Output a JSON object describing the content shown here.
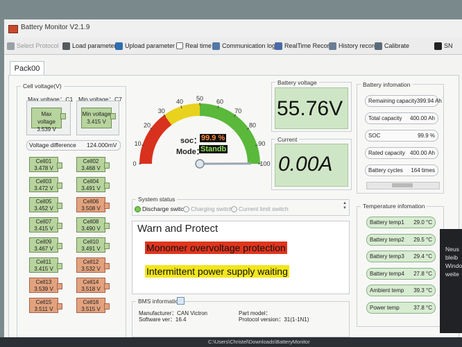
{
  "window": {
    "title": "Battery Monitor V2.1.9"
  },
  "toolbar": [
    {
      "label": "Select Protocol",
      "icon": "protocol-icon",
      "color": "#9aa0a6",
      "disabled": true
    },
    {
      "label": "Load parameter",
      "icon": "load-icon",
      "color": "#555a60",
      "disabled": false
    },
    {
      "label": "Upload parameter",
      "icon": "upload-icon",
      "color": "#2f6db0",
      "disabled": false
    },
    {
      "label": "Real time",
      "icon": "checkbox-icon",
      "color": "#3d3d3d",
      "disabled": false
    },
    {
      "label": "Communication log",
      "icon": "log-icon",
      "color": "#5277a6",
      "disabled": false
    },
    {
      "label": "RealTime Record",
      "icon": "record-icon",
      "color": "#4a6aa8",
      "disabled": false
    },
    {
      "label": "History record",
      "icon": "history-icon",
      "color": "#6a7d95",
      "disabled": false
    },
    {
      "label": "Calibrate",
      "icon": "calibrate-icon",
      "color": "#5b6a78",
      "disabled": false
    },
    {
      "label": "SN",
      "icon": "barcode-icon",
      "color": "#222222",
      "disabled": false
    }
  ],
  "tab": {
    "label": "Pack00"
  },
  "cell_voltage": {
    "group_label": "Cell voltage(V)",
    "max_header": "Max voltage：C1",
    "min_header": "Min voltage：C7",
    "max_name": "Max voltage",
    "max_value": "3.539 V",
    "min_name": "Min voltage",
    "min_value": "3.415 V",
    "diff_label": "Voltage difference",
    "diff_value": "124.000mV",
    "cells": [
      {
        "name": "Cell01",
        "value": "3.478 V",
        "state": "normal"
      },
      {
        "name": "Cell02",
        "value": "3.468 V",
        "state": "normal"
      },
      {
        "name": "Cell03",
        "value": "3.472 V",
        "state": "normal"
      },
      {
        "name": "Cell04",
        "value": "3.491 V",
        "state": "normal"
      },
      {
        "name": "Cell05",
        "value": "3.452 V",
        "state": "normal"
      },
      {
        "name": "Cell06",
        "value": "3.508 V",
        "state": "high"
      },
      {
        "name": "Cell07",
        "value": "3.415 V",
        "state": "normal"
      },
      {
        "name": "Cell08",
        "value": "3.490 V",
        "state": "normal"
      },
      {
        "name": "Cell09",
        "value": "3.467 V",
        "state": "normal"
      },
      {
        "name": "Cell10",
        "value": "3.491 V",
        "state": "normal"
      },
      {
        "name": "Cell11",
        "value": "3.415 V",
        "state": "normal"
      },
      {
        "name": "Cell12",
        "value": "3.532 V",
        "state": "high"
      },
      {
        "name": "Cell13",
        "value": "3.539 V",
        "state": "high"
      },
      {
        "name": "Cell14",
        "value": "3.518 V",
        "state": "high"
      },
      {
        "name": "Cell15",
        "value": "3.511 V",
        "state": "high"
      },
      {
        "name": "Cell16",
        "value": "3.515 V",
        "state": "high"
      }
    ]
  },
  "gauge": {
    "ticks": [
      "0",
      "10",
      "20",
      "30",
      "40",
      "50",
      "60",
      "70",
      "80",
      "90",
      "100"
    ],
    "soc_label": "soc：",
    "soc_value": "99.9 %",
    "soc_fraction": 0.999,
    "mode_label": "Mode：",
    "mode_value": "Standb",
    "colors": {
      "low": "#d8321e",
      "mid": "#e8d21e",
      "high": "#5ab83a"
    }
  },
  "battery_voltage": {
    "label": "Battery voltage",
    "value": "55.76V"
  },
  "current": {
    "label": "Current",
    "value": "0.00A"
  },
  "information": {
    "label": "Battery infomation",
    "rows": [
      {
        "name": "Remaining capacity",
        "value": "399.94 Ah"
      },
      {
        "name": "Total capacity",
        "value": "400.00 Ah"
      },
      {
        "name": "SOC",
        "value": "99.9 %"
      },
      {
        "name": "Rated capacity",
        "value": "400.00 Ah"
      },
      {
        "name": "Battery cycles",
        "value": "164 times"
      }
    ]
  },
  "system_status": {
    "label": "System status",
    "items": [
      {
        "label": "Discharge switch",
        "active": true
      },
      {
        "label": "Charging switch",
        "active": false
      },
      {
        "label": "Current limit switch",
        "active": false
      }
    ]
  },
  "warn": {
    "title": "Warn and Protect",
    "items": [
      {
        "text": "Monomer overvoltage protection",
        "color": "#e0361e"
      },
      {
        "text": "Intermittent power supply waiting",
        "color": "#f2e61c"
      }
    ]
  },
  "temperature": {
    "label": "Temperature infomation",
    "rows": [
      {
        "name": "Battery temp1",
        "value": "29.0 °C"
      },
      {
        "name": "Battery temp2",
        "value": "29.5 °C"
      },
      {
        "name": "Battery temp3",
        "value": "29.4 °C"
      },
      {
        "name": "Battery temp4",
        "value": "27.8 °C"
      },
      {
        "name": "Ambient temp",
        "value": "39.3 °C"
      },
      {
        "name": "Power temp",
        "value": "37.8 °C"
      }
    ]
  },
  "bms": {
    "label": "BMS information",
    "manufacturer": "Manufacturer：CAN Victron",
    "software": "Software ver：16.4",
    "part_model": "Part model：",
    "protocol": "Protocol version：31(1-1N1)"
  },
  "notification": {
    "lines": [
      "Neus",
      "bleib",
      "Windo",
      "weite"
    ]
  },
  "statusbar": {
    "path": "C:\\Users\\Christel\\Downloads\\BatteryMonitor"
  }
}
